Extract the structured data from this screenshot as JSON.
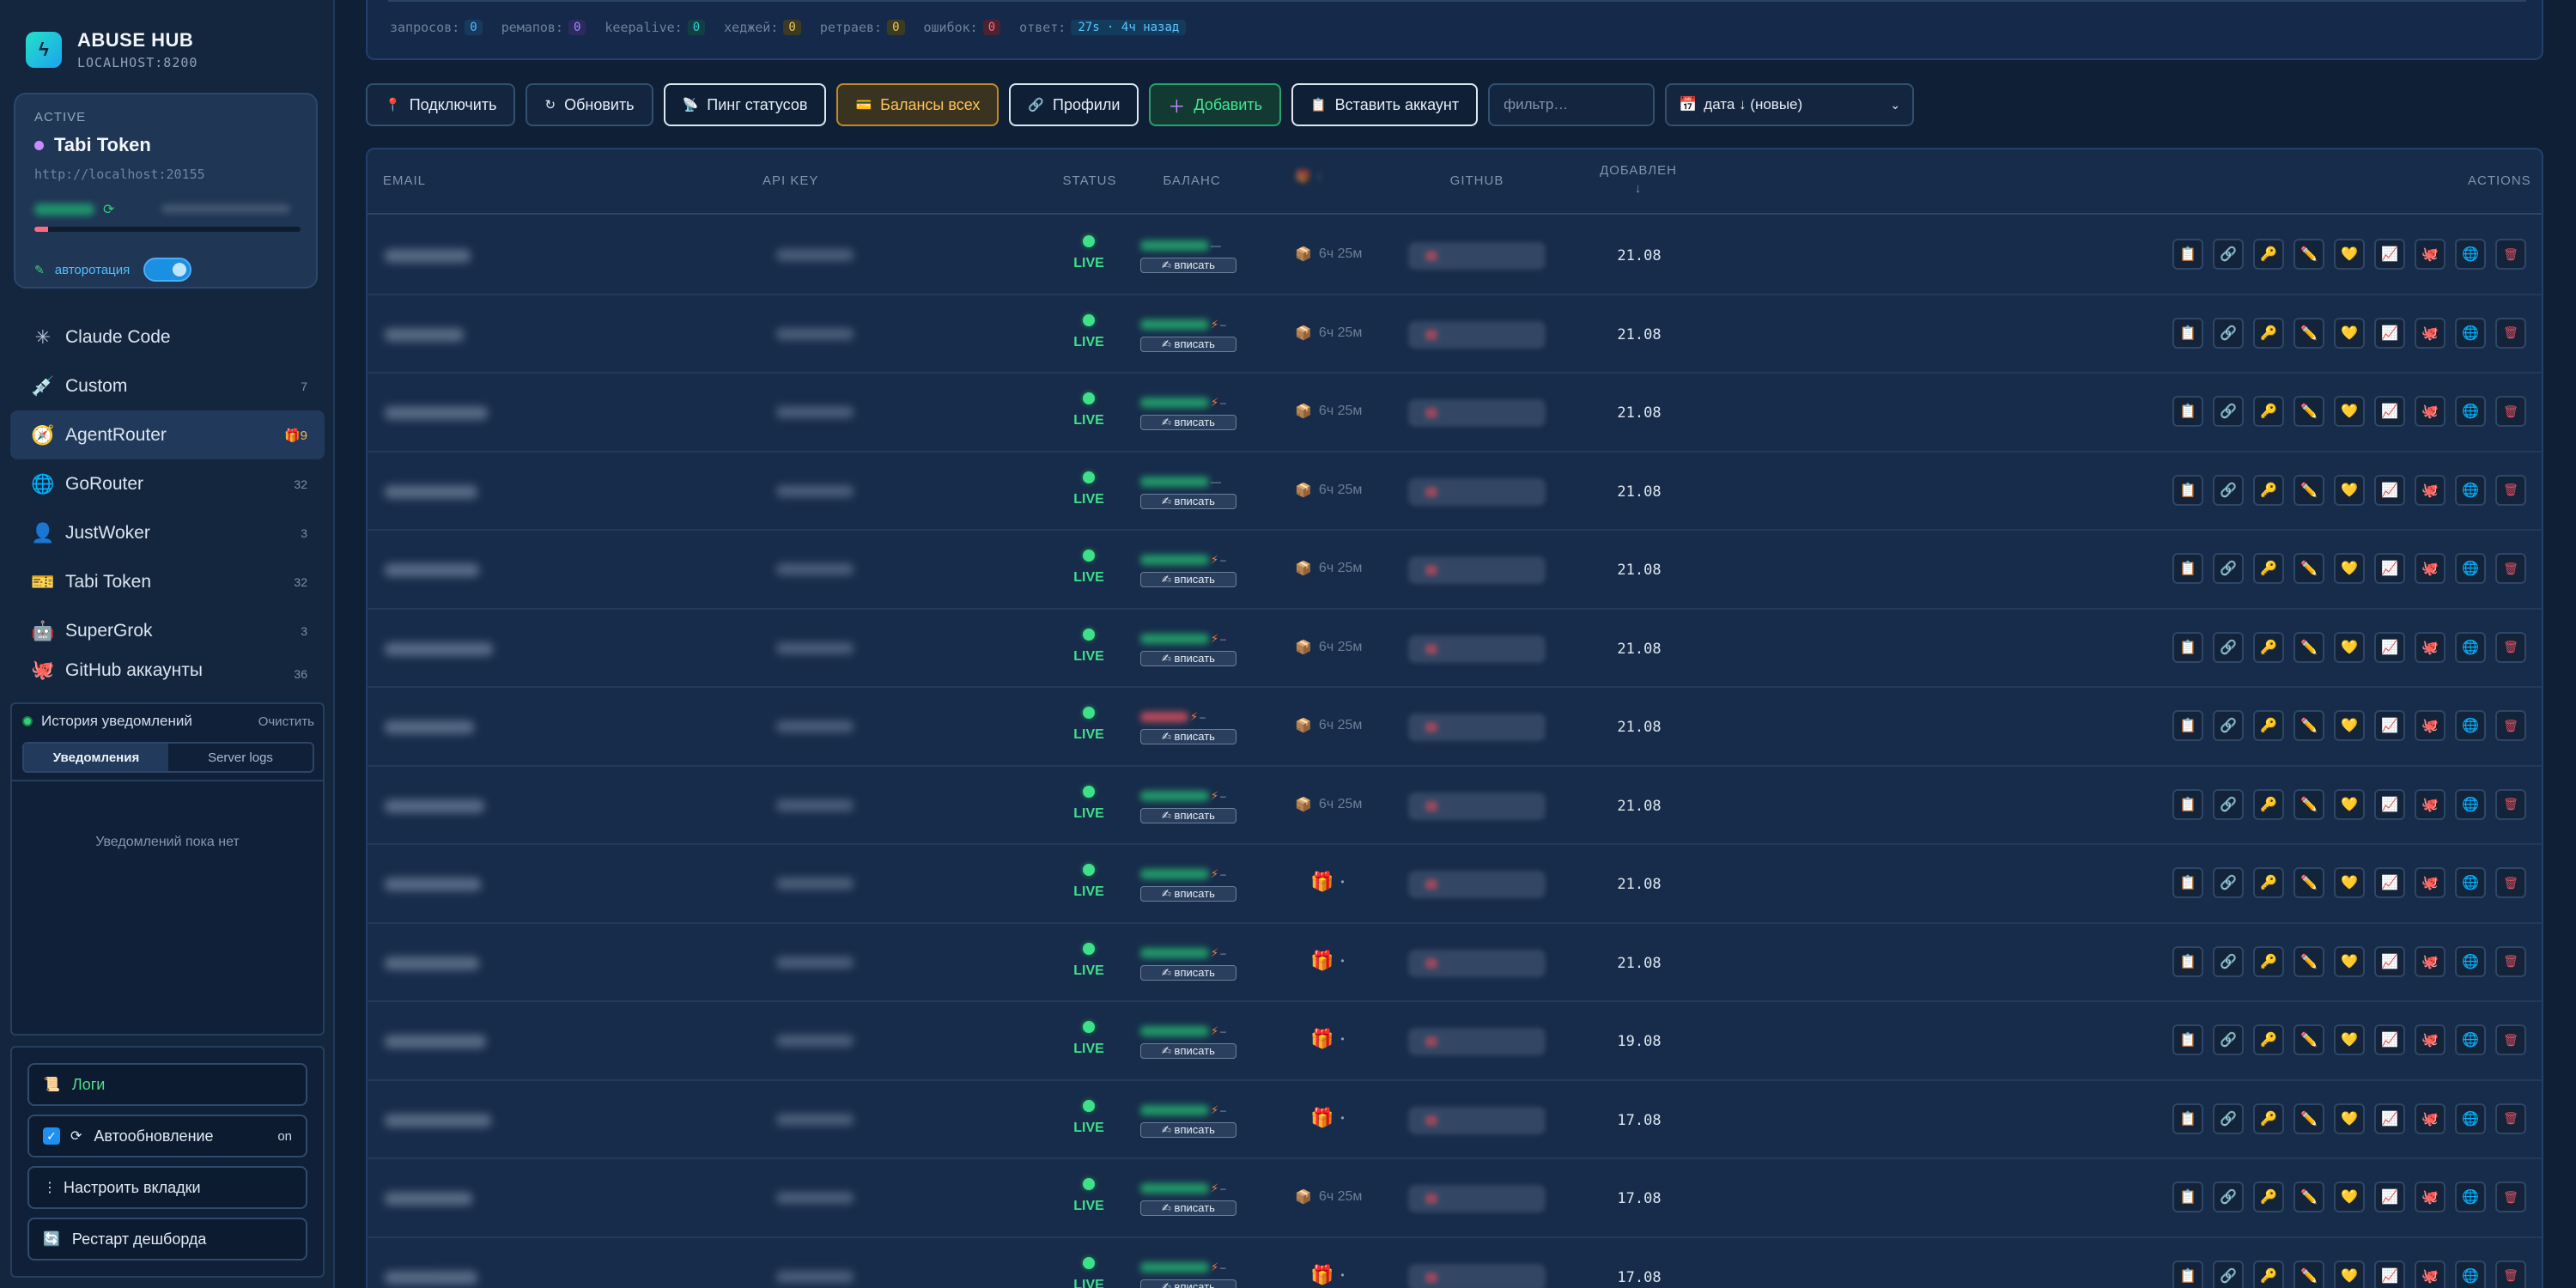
{
  "brand": {
    "title": "ABUSE HUB",
    "subtitle": "LOCALHOST:8200",
    "logo_icon": "bolt-icon"
  },
  "active": {
    "label": "ACTIVE",
    "name": "Tabi Token",
    "url": "http://localhost:20155",
    "autorotation_label": "авторотация",
    "autorotation_on": true
  },
  "nav": [
    {
      "label": "Claude Code",
      "icon": "sparkle-icon",
      "count": ""
    },
    {
      "label": "Custom",
      "icon": "syringe-icon",
      "count": "7"
    },
    {
      "label": "AgentRouter",
      "icon": "compass-icon",
      "count": "🎁9",
      "selected": true
    },
    {
      "label": "GoRouter",
      "icon": "globe-icon",
      "count": "32"
    },
    {
      "label": "JustWoker",
      "icon": "person-icon",
      "count": "3"
    },
    {
      "label": "Tabi Token",
      "icon": "ticket-icon",
      "count": "32"
    },
    {
      "label": "SuperGrok",
      "icon": "robot-icon",
      "count": "3"
    },
    {
      "label": "GitHub аккаунты",
      "icon": "octopus-icon",
      "count": "36"
    }
  ],
  "notifications": {
    "title": "История уведомлений",
    "clear": "Очистить",
    "tabs": [
      "Уведомления",
      "Server logs"
    ],
    "empty": "Уведомлений пока нет"
  },
  "bottom": {
    "logs": "Логи",
    "autoupdate": "Автообновление",
    "autoupdate_state": "on",
    "tabs_config": "Настроить вкладки",
    "restart": "Рестарт дешборда"
  },
  "stats": {
    "requests_label": "запросов:",
    "requests": "0",
    "remaps_label": "ремапов:",
    "remaps": "0",
    "keepalive_label": "keepalive:",
    "keepalive": "0",
    "hedges_label": "хеджей:",
    "hedges": "0",
    "retries_label": "ретраев:",
    "retries": "0",
    "errors_label": "ошибок:",
    "errors": "0",
    "answer_label": "ответ:",
    "answer": "27s · 4ч назад"
  },
  "toolbar": {
    "connect": "Подключить",
    "refresh": "Обновить",
    "ping": "Пинг статусов",
    "balances": "Балансы всех",
    "profiles": "Профили",
    "add": "Добавить",
    "paste": "Вставить аккаунт",
    "filter_placeholder": "фильтр…",
    "sort": "дата ↓ (новые)"
  },
  "table": {
    "headers": {
      "email": "EMAIL",
      "api_key": "API KEY",
      "status": "STATUS",
      "balance": "БАЛАНС",
      "github": "GITHUB",
      "added": "ДОБАВЛЕН",
      "added_arrow": "↓",
      "actions": "ACTIONS"
    },
    "live_label": "LIVE",
    "write_label": "✍ вписать",
    "tier_label": "6ч 25м",
    "rows": [
      {
        "date": "21.08",
        "marker": "tier",
        "bolt": false
      },
      {
        "date": "21.08",
        "marker": "tier",
        "bolt": true
      },
      {
        "date": "21.08",
        "marker": "tier",
        "bolt": true
      },
      {
        "date": "21.08",
        "marker": "tier",
        "bolt": false
      },
      {
        "date": "21.08",
        "marker": "tier",
        "bolt": true
      },
      {
        "date": "21.08",
        "marker": "tier",
        "bolt": true
      },
      {
        "date": "21.08",
        "marker": "tier",
        "bolt": true
      },
      {
        "date": "21.08",
        "marker": "tier",
        "bolt": true
      },
      {
        "date": "21.08",
        "marker": "gift",
        "bolt": true
      },
      {
        "date": "21.08",
        "marker": "gift",
        "bolt": true
      },
      {
        "date": "19.08",
        "marker": "gift",
        "bolt": true
      },
      {
        "date": "17.08",
        "marker": "gift",
        "bolt": true
      },
      {
        "date": "17.08",
        "marker": "tier",
        "bolt": true
      },
      {
        "date": "17.08",
        "marker": "gift",
        "bolt": true
      }
    ],
    "action_icons": [
      "clipboard-icon",
      "link-icon",
      "key-icon",
      "pencil-icon",
      "heart-icon",
      "chart-icon",
      "octopus-icon",
      "globe-icon",
      "trash-icon"
    ]
  }
}
